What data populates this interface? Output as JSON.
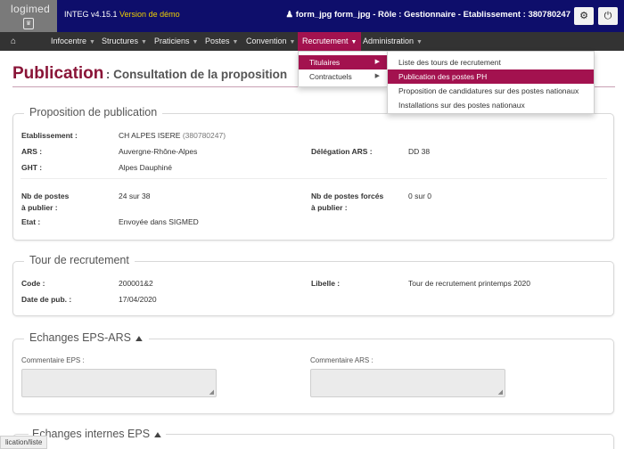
{
  "header": {
    "logo": "logimed",
    "version": "INTEG v4.15.1",
    "version_note": "Version de démo",
    "user_info": "form_jpg form_jpg - Rôle : Gestionnaire - Etablissement : 380780247",
    "user_icon": "user-icon",
    "settings_icon": "gear-icon",
    "power_icon": "power-icon"
  },
  "nav": {
    "home_icon": "home-icon",
    "items": [
      "Infocentre",
      "Structures",
      "Praticiens",
      "Postes",
      "Convention",
      "Recrutement",
      "Administration"
    ],
    "active": "Recrutement"
  },
  "dropdown": {
    "level1": [
      "Titulaires",
      "Contractuels"
    ],
    "level2": [
      "Liste des tours de recrutement",
      "Publication des postes PH",
      "Proposition de candidatures sur des postes nationaux",
      "Installations sur des postes nationaux"
    ]
  },
  "page": {
    "title": "Publication",
    "subtitle": ": Consultation de la proposition"
  },
  "proposition": {
    "title": "Proposition de publication",
    "etablissement_label": "Etablissement :",
    "etablissement_value": "CH ALPES ISERE",
    "etablissement_code": "(380780247)",
    "ars_label": "ARS :",
    "ars_value": "Auvergne-Rhône-Alpes",
    "delegation_label": "Délégation ARS :",
    "delegation_value": "DD 38",
    "ght_label": "GHT :",
    "ght_value": "Alpes Dauphiné",
    "nb_postes_label_1": "Nb de postes",
    "nb_postes_label_2": "à publier :",
    "nb_postes_value": "24 sur 38",
    "nb_forces_label_1": "Nb de postes forcés",
    "nb_forces_label_2": "à publier :",
    "nb_forces_value": "0 sur 0",
    "etat_label": "Etat :",
    "etat_value": "Envoyée dans SIGMED"
  },
  "tour": {
    "title": "Tour de recrutement",
    "code_label": "Code :",
    "code_value": "200001&2",
    "libelle_label": "Libelle :",
    "libelle_value": "Tour de recrutement printemps 2020",
    "date_label": "Date de pub. :",
    "date_value": "17/04/2020"
  },
  "echanges": {
    "title": "Echanges EPS-ARS",
    "comment_eps_label": "Commentaire EPS :",
    "comment_eps_value": "",
    "comment_ars_label": "Commentaire ARS :",
    "comment_ars_value": "",
    "chevron_icon": "chevron-up-icon"
  },
  "echanges_internes": {
    "title": "Echanges internes EPS",
    "chevron_icon": "chevron-up-icon"
  },
  "status_bar": "lication/liste"
}
